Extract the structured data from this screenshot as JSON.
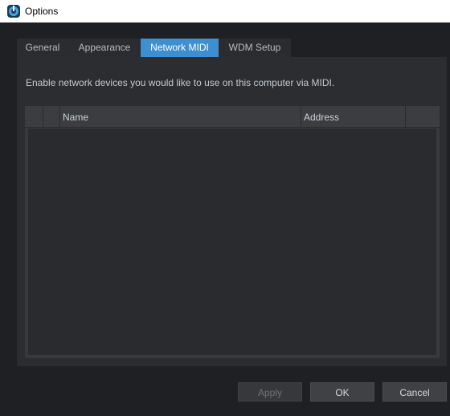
{
  "window": {
    "title": "Options",
    "app_icon": "studio-one-icon"
  },
  "tabs": [
    {
      "label": "General",
      "active": false
    },
    {
      "label": "Appearance",
      "active": false
    },
    {
      "label": "Network MIDI",
      "active": true
    },
    {
      "label": "WDM Setup",
      "active": false
    }
  ],
  "panel": {
    "instructions": "Enable network devices you would like to use on this computer via MIDI."
  },
  "table": {
    "columns": [
      "",
      "",
      "Name",
      "Address"
    ],
    "rows": []
  },
  "buttons": {
    "apply": "Apply",
    "ok": "OK",
    "cancel": "Cancel"
  },
  "colors": {
    "active_tab": "#3e8fd0",
    "background": "#1f2023"
  }
}
